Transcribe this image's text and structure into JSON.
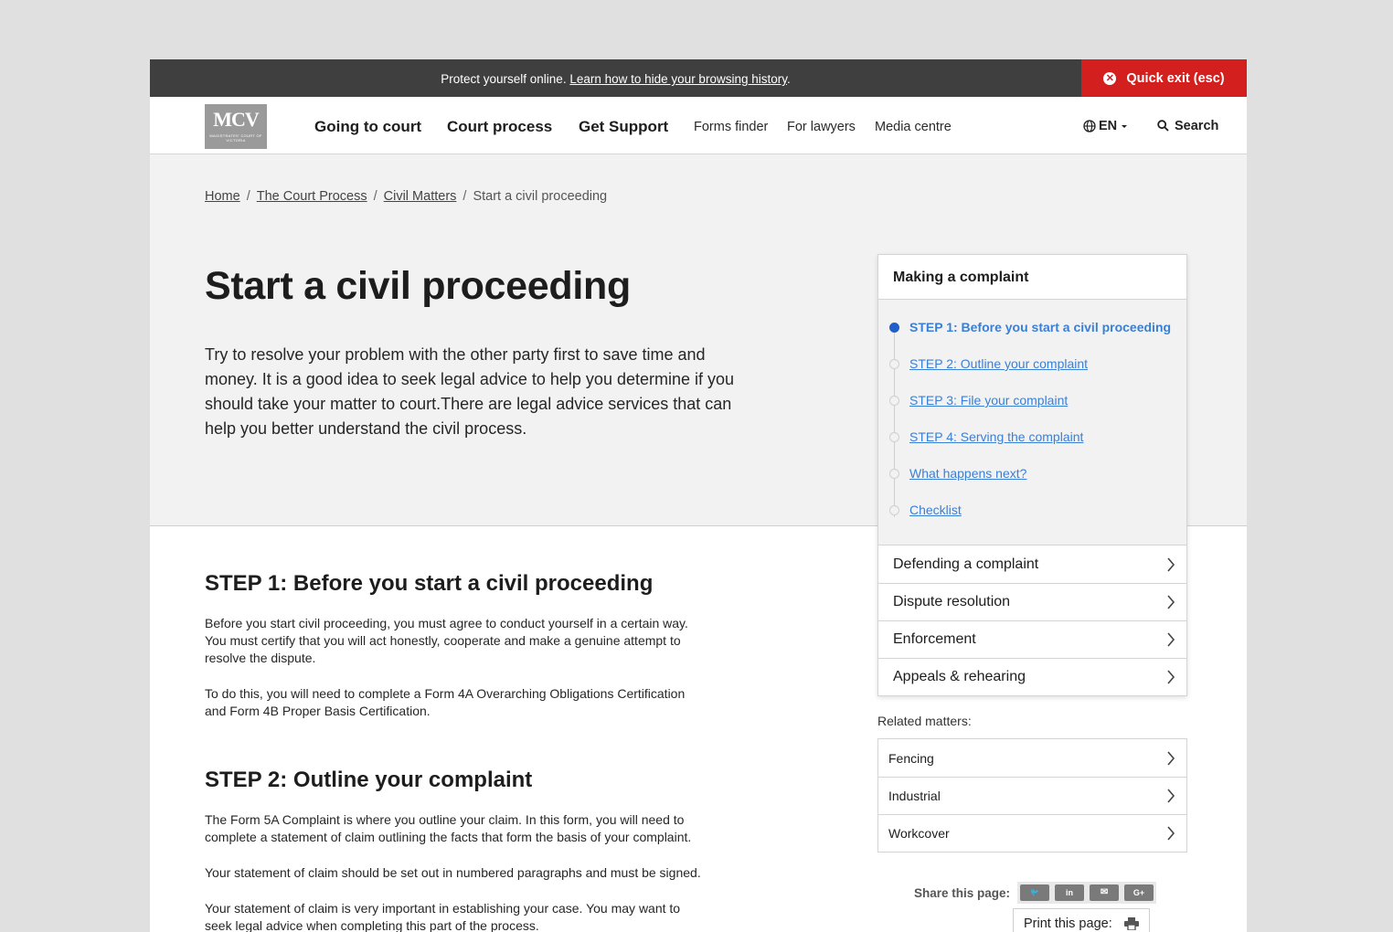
{
  "alert": {
    "text": "Protect yourself online.",
    "link": "Learn how to hide your browsing history",
    "suffix": ".",
    "quick_exit": "Quick exit (esc)"
  },
  "logo": {
    "text": "MCV",
    "subtext": "MAGISTRATES' COURT OF VICTORIA"
  },
  "nav": {
    "main": [
      "Going to court",
      "Court process",
      "Get Support"
    ],
    "secondary": [
      "Forms finder",
      "For lawyers",
      "Media centre"
    ],
    "language": "EN",
    "search": "Search"
  },
  "breadcrumb": {
    "items": [
      "Home",
      "The Court Process",
      "Civil Matters"
    ],
    "current": "Start a civil proceeding",
    "separator": "/"
  },
  "hero": {
    "title": "Start a civil proceeding",
    "intro": "Try to resolve your problem with the other party first to save time and money. It is a good idea to seek legal advice to help you determine if you should take your matter to court.There are legal advice services that can help you better understand the civil process."
  },
  "content": {
    "step1": {
      "heading": "STEP 1: Before you start a civil proceeding",
      "p1": "Before you start civil proceeding, you must agree to conduct yourself in a certain way. You must certify that you will act honestly, cooperate and make a genuine attempt to resolve the dispute.",
      "p2": "To do this, you will need to complete a Form 4A Overarching Obligations Certification and Form 4B Proper Basis Certification."
    },
    "step2": {
      "heading": "STEP 2: Outline your complaint",
      "p1": "The Form 5A Complaint is where you outline your claim. In this form, you will need to complete a statement of claim outlining the facts that form the basis of your complaint.",
      "p2": "Your statement of claim should be set out in numbered paragraphs and must be signed.",
      "p3": "Your statement of claim is very important in establishing your case. You may want to seek legal advice when completing this part of the process."
    }
  },
  "sidebar": {
    "title": "Making a complaint",
    "steps": [
      {
        "label": "STEP 1: Before you start a civil proceeding",
        "active": true
      },
      {
        "label": "STEP 2: Outline your complaint",
        "active": false
      },
      {
        "label": "STEP 3: File your complaint",
        "active": false
      },
      {
        "label": "STEP 4: Serving the complaint",
        "active": false
      },
      {
        "label": "What happens next?",
        "active": false
      },
      {
        "label": "Checklist",
        "active": false
      }
    ],
    "sections": [
      "Defending a complaint",
      "Dispute resolution",
      "Enforcement",
      "Appeals & rehearing"
    ]
  },
  "related": {
    "label": "Related matters:",
    "items": [
      "Fencing",
      "Industrial",
      "Workcover"
    ]
  },
  "share": {
    "label": "Share this page:",
    "buttons": [
      {
        "icon": "twitter-icon",
        "glyph": "🐦"
      },
      {
        "icon": "linkedin-icon",
        "glyph": "in"
      },
      {
        "icon": "email-icon",
        "glyph": "✉"
      },
      {
        "icon": "google-plus-icon",
        "glyph": "G+"
      }
    ],
    "print_label": "Print this page:"
  },
  "colors": {
    "alert_bg": "#3f3f3f",
    "quick_exit_bg": "#d41f1f",
    "link_blue": "#3a7fd6",
    "active_dot": "#1f5fcc",
    "hero_bg": "#f2f2f2"
  }
}
